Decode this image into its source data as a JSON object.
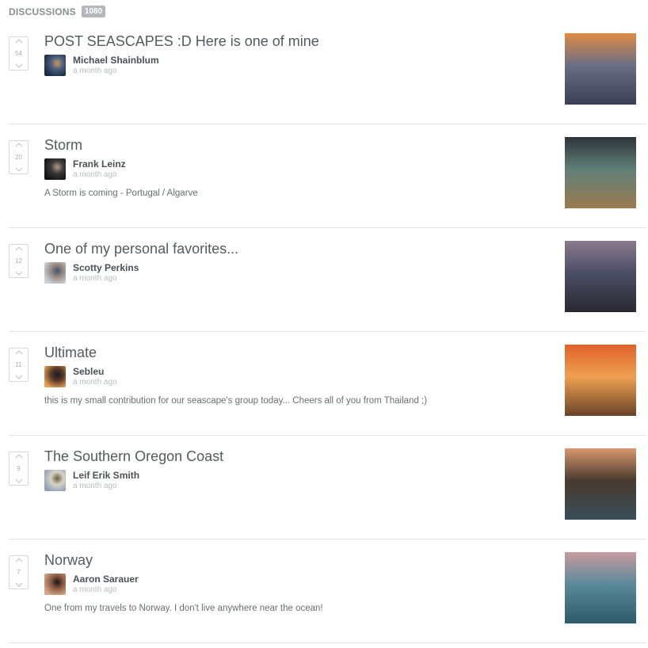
{
  "header": {
    "title": "DISCUSSIONS",
    "count": "1080"
  },
  "discussions": [
    {
      "title": "POST SEASCAPES :D Here is one of mine",
      "votes": "54",
      "author": "Michael Shainblum",
      "time": "a month ago",
      "description": "",
      "avatar_colors": [
        "#1b2a44",
        "#4a5d80",
        "#c89a5a"
      ],
      "thumb_colors": [
        "#e08a44",
        "#6a6f86",
        "#3b3f55"
      ]
    },
    {
      "title": "Storm",
      "votes": "20",
      "author": "Frank Leinz",
      "time": "a month ago",
      "description": "A Storm is coming - Portugal / Algarve",
      "avatar_colors": [
        "#121212",
        "#3a3a3a",
        "#b09a88"
      ],
      "thumb_colors": [
        "#2e3438",
        "#5f7f78",
        "#9c7a50"
      ]
    },
    {
      "title": "One of my personal favorites...",
      "votes": "12",
      "author": "Scotty Perkins",
      "time": "a month ago",
      "description": "",
      "avatar_colors": [
        "#c9d4e0",
        "#9a8a80",
        "#3e5672"
      ],
      "thumb_colors": [
        "#8b7a8c",
        "#4c4e66",
        "#2a2830"
      ]
    },
    {
      "title": "Ultimate",
      "votes": "11",
      "author": "Sebleu",
      "time": "a month ago",
      "description": "this is my small contribution for our seascape's group today... Cheers all of you from Thailand ;)",
      "avatar_colors": [
        "#e8a050",
        "#5a3a2a",
        "#1a1a22"
      ],
      "thumb_colors": [
        "#e0622c",
        "#f0a050",
        "#6a4428"
      ]
    },
    {
      "title": "The Southern Oregon Coast",
      "votes": "9",
      "author": "Leif Erik Smith",
      "time": "a month ago",
      "description": "",
      "avatar_colors": [
        "#8aa0b8",
        "#d8d2c4",
        "#6a5a3a"
      ],
      "thumb_colors": [
        "#d89870",
        "#4a3a2e",
        "#3a4e5a"
      ]
    },
    {
      "title": "Norway",
      "votes": "7",
      "author": "Aaron Sarauer",
      "time": "a month ago",
      "description": "One from my travels to Norway. I don't live anywhere near the ocean!",
      "avatar_colors": [
        "#d8a888",
        "#8a5a44",
        "#1a1414"
      ],
      "thumb_colors": [
        "#c89aa0",
        "#5a8a9a",
        "#2e5a6a"
      ]
    }
  ],
  "icons": {
    "upvote": "chevron-up-icon",
    "downvote": "chevron-down-icon"
  }
}
